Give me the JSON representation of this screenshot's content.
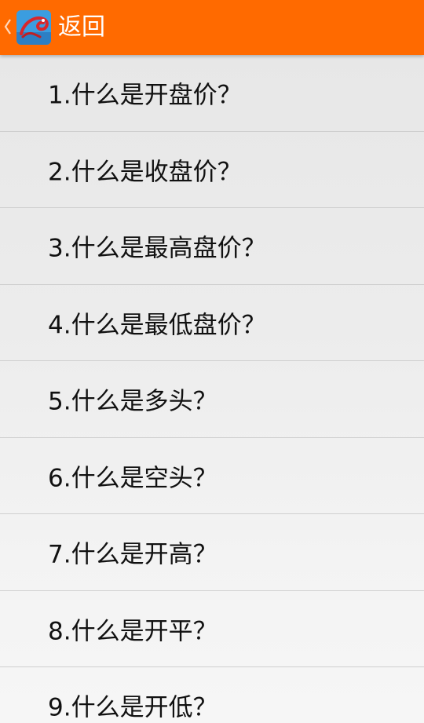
{
  "actionbar": {
    "back_label": "返回",
    "up_icon": "chevron-left-icon",
    "app_icon": "app-logo-icon",
    "color": "#ff6a00"
  },
  "faq": {
    "items": [
      {
        "label": "1.什么是开盘价？"
      },
      {
        "label": "2.什么是收盘价？"
      },
      {
        "label": "3.什么是最高盘价？"
      },
      {
        "label": "4.什么是最低盘价？"
      },
      {
        "label": "5.什么是多头？"
      },
      {
        "label": "6.什么是空头？"
      },
      {
        "label": "7.什么是开高？"
      },
      {
        "label": "8.什么是开平？"
      },
      {
        "label": "9.什么是开低？"
      }
    ]
  }
}
